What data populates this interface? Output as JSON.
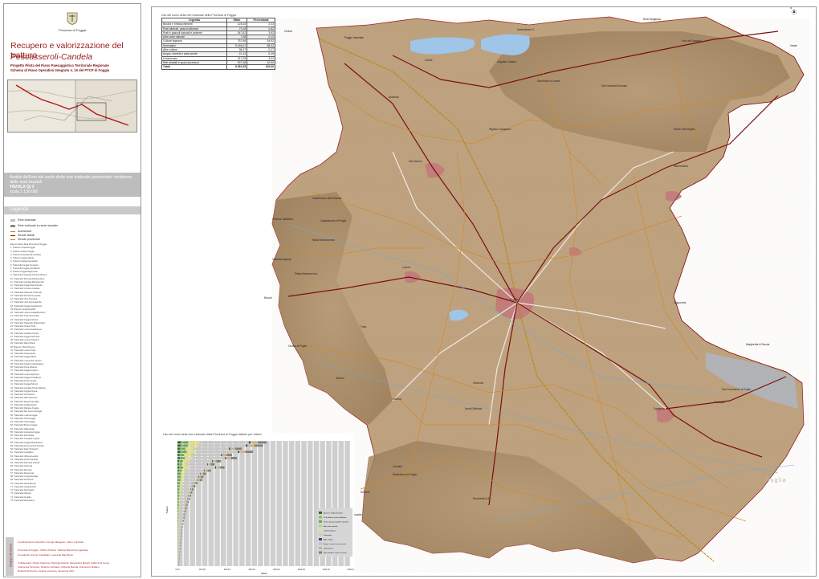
{
  "left": {
    "province_label": "Provincia di Foggia",
    "title": "Recupero e valorizzazione del tratturo",
    "subtitle": "Pescasseroli-Candela",
    "desc1": "Progetto Pilota del Piano Paesaggistico Territoriale Regionale",
    "desc2": "Schema di Piano Operativo Integrato n. 10 del PTCP di Foggia",
    "analysis_title": "Analisi dell'uso del suolo della rete tratturale provinciale: incidenza delle sedi stradali",
    "tavola": "TAVOLA QI 3",
    "scala": "scala 1:130.000",
    "legend_title": "Legenda",
    "legend_items": [
      {
        "label": "Rete tratturale",
        "color": "#bdbdbd"
      },
      {
        "label": "Rete tratturale su sede stradale",
        "color": "#8a8a8a"
      },
      {
        "label": "Autostrade",
        "color": "#b8860b"
      },
      {
        "label": "Strade statali",
        "color": "#7a1010"
      },
      {
        "label": "Strade provinciali",
        "color": "#d08a2a"
      }
    ],
    "tratturi_heading": "Elenco tratturi della Provincia di Foggia",
    "tratturi": [
      "1. Tratturo L'Aquila-Foggia",
      "2. Tratturo Celano-Foggia",
      "3. Tratturo Pescasseroli-Candela",
      "4. Tratturo Foggia-Ofanto",
      "5. Tratturo Foggia-Campolato",
      "6. Tratturello Foggia-Tressanti",
      "7. Tratturello Foggia-Ciccallento",
      "8. Tratturo Foggia-Zapponeta",
      "9. Tratturello Cerignola-Ponte di Bovino",
      "10. Tratturello Stornara-Montemilone",
      "11. Tratturello Candela-Montegentile",
      "12. Tratturello Foggia-Sannicandro",
      "13. Tratturello Cervaro-Candela",
      "14. Tratturello Ortanova-Tressanti",
      "15. Tratturello Rocchetta-Lavello",
      "16. Tratturello Orta-Tressanti",
      "17. Tratturello Ururi-Serracapriola",
      "18. Tratturello Foggia-Castelluccio",
      "19. Braccio Cerignola-Melfi",
      "20. Tratturello Lucera-Castelfiorentino",
      "21. Tratturello Troia-Incoronata",
      "22. Tratturello Foggia-Ordona",
      "23. Tratturello Tratturello Motta-Pietra",
      "24. Tratturello Orsara-Troia",
      "25. Tratturello Lucera-Casalnuovo",
      "26. Tratturello Candela-Contra",
      "27. Tratturello Foggia-Verticchio",
      "28. Tratturello Lucera-Volturino",
      "29. Tratturello Salpi-Ofanto",
      "30. Braccio Orta-Ortanova",
      "31. Tratturello Lucera-Troia",
      "32. Tratturello Camporeale",
      "33. Tratturello Foggia-Motta",
      "34. Tratturello Lucera-San Severo",
      "35. Tratturello Foggia-Castelpagano",
      "36. Tratturello Ponte Albanito",
      "37. Tratturello Foggia-Carpino",
      "38. Tratturello Lucera-Apricena",
      "39. Tratturello Foggia-Ciccallento",
      "40. Tratturello Ascoli-Lavello",
      "41. Tratturello Foggia-Palmori",
      "42. Tratturello Candela-Ponte Albanito",
      "43. Tratturello Foggia-Orsara",
      "44. Tratturello Via d'Ascoli",
      "45. Tratturello Vado Pannone",
      "46. Tratturello Zapponeta-Salpi",
      "47. Tratturello Foggia-Ascoli",
      "48. Tratturello Rignano-Foggia",
      "49. Tratturello San Severo-Foggia",
      "50. Tratturello Lucera-Foggia",
      "51. Tratturello Troia-Foggia",
      "52. Tratturello Orta-Foggia",
      "53. Tratturello Bovino-Foggia",
      "54. Tratturello Vallecanale",
      "55. Tratturello Cerignola-Foggia",
      "56. Tratturello Stornarella",
      "57. Tratturello Tressanti-Lupara",
      "58. Tratturello Foggia-Manfredonia",
      "59. Tratturello Apricena-Sannicandro",
      "60. Tratturello Salpi-Trinitapoli",
      "61. Tratturello Candelaro",
      "62. Tratturello Ordona-Lavello",
      "63. Tratturello Ascoli-Candela",
      "64. Tratturello Mezzana Grande",
      "65. Tratturello Ortanova",
      "66. Tratturello Stornara",
      "67. Tratturello Zapponeta",
      "68. Tratturello Cerignola-Salpi",
      "69. Tratturello Rocchetta",
      "70. Tratturello Motta-Biccari",
      "71. Tratturello Casalvecchio",
      "72. Tratturello Sant'Agata",
      "73. Tratturello Deliceto",
      "74. Tratturello Accadia",
      "75. Tratturello Monteleone"
    ],
    "credits_vertical": "Gruppo di lavoro",
    "credits": [
      "Coordinamento scientifico: Giorgio Mangano, Arturo Cucciolla",
      "Provincia di Foggia - Ufficio di Piano: Stefano Biscotti (progettista)",
      "Consulenti: Antonio Castellani, Leonardo Marchione",
      "Collaboratori: Nicola Cascione, Pierluigi Assetta, Alessandra Marulli, Sabrina Di Genio",
      "Francesca Tammaro, Roberto Giordano, Roberta Bocola, Francesco Mattani",
      "Roberta Di Nunzio, Grazia Lopiccolo, Giovanna Vinci"
    ]
  },
  "landuse": {
    "title": "Uso del suolo della rete tratturale della Provincia di Foggia",
    "headers": [
      "Legenda",
      "Ettari",
      "Percentuale"
    ],
    "rows": [
      {
        "label": "Boschi e rimboschimenti",
        "ha": "128,03",
        "pct": "2,03"
      },
      {
        "label": "Prati alberati, pascoli alberati",
        "ha": "73,18",
        "pct": "0,82"
      },
      {
        "label": "Prati e pascoli naturali e praterie",
        "ha": "347,62",
        "pct": "3,92"
      },
      {
        "label": "Altre aree naturali",
        "ha": "7,08",
        "pct": "0,12"
      },
      {
        "label": "Colture legnose",
        "ha": "757,68",
        "pct": "34,92"
      },
      {
        "label": "Seminativi",
        "ha": "5.155,47",
        "pct": "58,02"
      },
      {
        "label": "Altre colture",
        "ha": "38,47",
        "pct": "0,27"
      },
      {
        "label": "Acque, torrenti e aree umide",
        "ha": "21,12",
        "pct": "0,19"
      },
      {
        "label": "Urbanizzato",
        "ha": "312,25",
        "pct": "3,92"
      },
      {
        "label": "Reti stradali e spazi accessori",
        "ha": "537,48",
        "pct": "10,00"
      }
    ],
    "total_label": "Totali",
    "total_ha": "8.382,25",
    "total_pct": "100,00"
  },
  "map": {
    "places": [
      {
        "name": "Rodi Garganico"
      },
      {
        "name": "Sannicandro G."
      },
      {
        "name": "Lesina"
      },
      {
        "name": "Cagnano Varano"
      },
      {
        "name": "Vico del Gargano"
      },
      {
        "name": "Vieste"
      },
      {
        "name": "Poggio Imperiale"
      },
      {
        "name": "Chieuti"
      },
      {
        "name": "Apricena"
      },
      {
        "name": "San Marco in Lamis"
      },
      {
        "name": "San Giovanni Rotondo"
      },
      {
        "name": "Monte Sant'Angelo"
      },
      {
        "name": "San Severo"
      },
      {
        "name": "Rignano Garganico"
      },
      {
        "name": "Manfredonia"
      },
      {
        "name": "Casalvecchio di Puglia"
      },
      {
        "name": "Castelnuovo della Daunia"
      },
      {
        "name": "Celenza Valfortore"
      },
      {
        "name": "Motta Montecorvino"
      },
      {
        "name": "Volturara Appula"
      },
      {
        "name": "Pietra Montecorvino"
      },
      {
        "name": "Lucera"
      },
      {
        "name": "Biccari"
      },
      {
        "name": "Foggia"
      },
      {
        "name": "Zapponeta"
      },
      {
        "name": "Troia"
      },
      {
        "name": "Orsara di Puglia"
      },
      {
        "name": "Bovino"
      },
      {
        "name": "Ordona"
      },
      {
        "name": "Ortanova"
      },
      {
        "name": "Margherita di Savoia"
      },
      {
        "name": "Cerignola"
      },
      {
        "name": "Ascoli Satriano"
      },
      {
        "name": "Candela"
      },
      {
        "name": "Deliceto"
      },
      {
        "name": "Rocchetta S.A."
      },
      {
        "name": "Monteleone di Puglia"
      },
      {
        "name": "Accadia"
      },
      {
        "name": "Trinitapoli"
      },
      {
        "name": "San Ferdinando di Puglia"
      }
    ],
    "region_label": "Puglia",
    "compass_label": "N"
  },
  "chart_data": {
    "type": "bar",
    "title": "Uso del suolo della rete tratturale della Provincia di Foggia distinto per tratturi",
    "orientation": "horizontal",
    "xlabel": "Ettari",
    "ylabel": "Tratturi",
    "xlim": [
      0,
      1400
    ],
    "xticks": [
      "0,00",
      "200,00",
      "400,00",
      "600,00",
      "800,00",
      "1000,00",
      "1200,00",
      "1400,00"
    ],
    "categories_count": 40,
    "series_colors": [
      "#2e6b2e",
      "#8fbf5a",
      "#6aa84f",
      "#b7d67a",
      "#e3e07a",
      "#c8c8c8",
      "#4a4a4a",
      "#9fc5e8",
      "#d9b26a",
      "#7f7f7f"
    ],
    "totals": [
      720,
      690,
      520,
      610,
      440,
      480,
      350,
      300,
      380,
      270,
      230,
      210,
      200,
      160,
      145,
      130,
      120,
      110,
      100,
      90,
      82,
      75,
      70,
      62,
      58,
      52,
      48,
      44,
      40,
      38,
      35,
      32,
      30,
      28,
      25,
      22,
      20,
      18,
      15,
      12
    ],
    "legend": [
      "Boschi e rimboschimenti",
      "Prati alberati, pascoli alberati",
      "Prati e pascoli naturali e praterie",
      "Altre aree naturali",
      "Colture legnose",
      "Seminativi",
      "Altre colture",
      "Acque, torrenti e aree umide",
      "Urbanizzato",
      "Reti stradali e spazi accessori"
    ]
  }
}
